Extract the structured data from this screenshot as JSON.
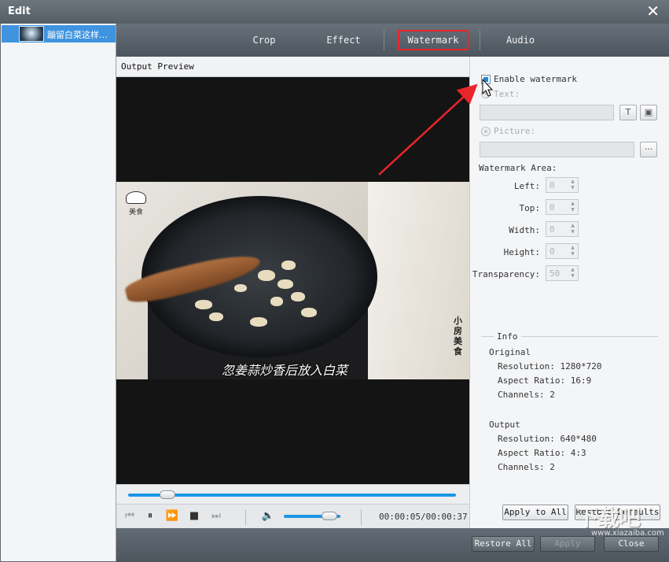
{
  "window": {
    "title": "Edit",
    "close_glyph": "✕"
  },
  "file_list": [
    {
      "name": "蹦留白菜这样…"
    }
  ],
  "tabs": [
    {
      "label": "Crop",
      "active": false
    },
    {
      "label": "Effect",
      "active": false
    },
    {
      "label": "Watermark",
      "active": true
    },
    {
      "label": "Audio",
      "active": false
    }
  ],
  "preview": {
    "header": "Output Preview",
    "subtitle": "忽姜蒜炒香后放入白菜",
    "logo_text": "美食",
    "side_text": "小房美食"
  },
  "playback": {
    "seek_progress": 0.12,
    "volume_level": 0.8,
    "timecode": "00:00:05/00:00:37",
    "icons": [
      "skip-back-icon",
      "pause-icon",
      "fast-forward-icon",
      "stop-icon",
      "skip-forward-icon",
      "volume-icon"
    ]
  },
  "watermark": {
    "enable_label": "Enable watermark",
    "enabled": true,
    "text_label": "Text:",
    "text_value": "",
    "picture_label": "Picture:",
    "picture_value": "",
    "font_button": "T",
    "color_button": "▣",
    "browse_button": "···",
    "area_label": "Watermark Area:",
    "fields": [
      {
        "label": "Left:",
        "value": "0"
      },
      {
        "label": "Top:",
        "value": "0"
      },
      {
        "label": "Width:",
        "value": "0"
      },
      {
        "label": "Height:",
        "value": "0"
      },
      {
        "label": "Transparency:",
        "value": "50"
      }
    ]
  },
  "info": {
    "heading": "Info",
    "original": {
      "title": "Original",
      "resolution": "Resolution: 1280*720",
      "aspect": "Aspect Ratio: 16:9",
      "channels": "Channels: 2"
    },
    "output": {
      "title": "Output",
      "resolution": "Resolution: 640*480",
      "aspect": "Aspect Ratio: 4:3",
      "channels": "Channels: 2"
    }
  },
  "buttons": {
    "apply_to_all": "Apply to All",
    "restore_defaults": "Restore Defaults",
    "restore_all": "Restore All",
    "apply": "Apply",
    "close": "Close"
  },
  "site_watermark": {
    "logo": "下载吧",
    "sub": "www.xiazaiba.com"
  },
  "colors": {
    "accent_blue": "#1a96e6",
    "highlight_red": "#e8262a",
    "selected_item": "#3f93df"
  }
}
